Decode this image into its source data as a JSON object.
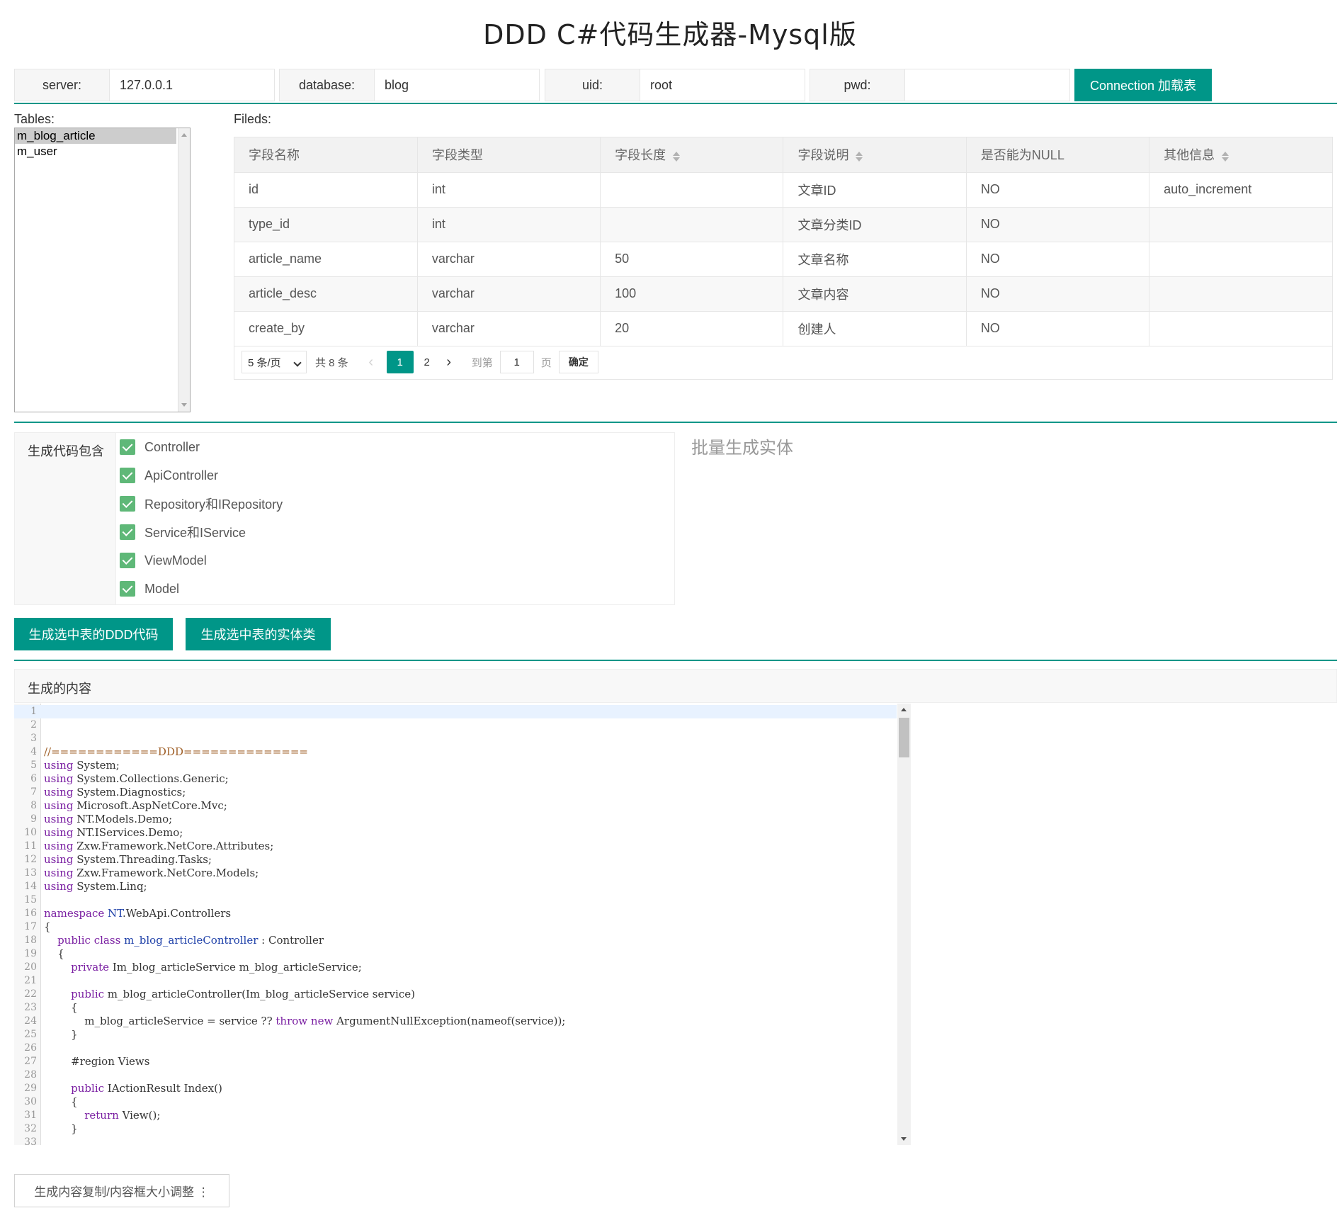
{
  "title": "DDD C#代码生成器-Mysql版",
  "connection": {
    "server_label": "server:",
    "server_value": "127.0.0.1",
    "database_label": "database:",
    "database_value": "blog",
    "uid_label": "uid:",
    "uid_value": "root",
    "pwd_label": "pwd:",
    "pwd_value": "",
    "connect_button": "Connection 加载表"
  },
  "tables": {
    "label": "Tables:",
    "items": [
      "m_blog_article",
      "m_user"
    ],
    "selected": "m_blog_article"
  },
  "fields": {
    "label": "Fileds:",
    "columns": [
      "字段名称",
      "字段类型",
      "字段长度",
      "字段说明",
      "是否能为NULL",
      "其他信息"
    ],
    "rows": [
      [
        "id",
        "int",
        "",
        "文章ID",
        "NO",
        "auto_increment"
      ],
      [
        "type_id",
        "int",
        "",
        "文章分类ID",
        "NO",
        ""
      ],
      [
        "article_name",
        "varchar",
        "50",
        "文章名称",
        "NO",
        ""
      ],
      [
        "article_desc",
        "varchar",
        "100",
        "文章内容",
        "NO",
        ""
      ],
      [
        "create_by",
        "varchar",
        "20",
        "创建人",
        "NO",
        ""
      ]
    ],
    "pager": {
      "page_size": "5 条/页",
      "total": "共 8 条",
      "prev": "‹",
      "pages": [
        "1",
        "2"
      ],
      "current": "1",
      "next": "›",
      "goto_label": "到第",
      "goto_value": "1",
      "page_unit": "页",
      "confirm": "确定"
    }
  },
  "options": {
    "label": "生成代码包含",
    "items": [
      "Controller",
      "ApiController",
      "Repository和IRepository",
      "Service和IService",
      "ViewModel",
      "Model"
    ]
  },
  "batch_title": "批量生成实体",
  "buttons": {
    "gen_ddd": "生成选中表的DDD代码",
    "gen_entity": "生成选中表的实体类",
    "copy_resize": "生成内容复制/内容框大小调整 ⋮"
  },
  "content_title": "生成的内容",
  "accent_color": "#009688",
  "code_lines": [
    "",
    "",
    "",
    "//============DDD==============",
    "using System;",
    "using System.Collections.Generic;",
    "using System.Diagnostics;",
    "using Microsoft.AspNetCore.Mvc;",
    "using NT.Models.Demo;",
    "using NT.IServices.Demo;",
    "using Zxw.Framework.NetCore.Attributes;",
    "using System.Threading.Tasks;",
    "using Zxw.Framework.NetCore.Models;",
    "using System.Linq;",
    "",
    "namespace NT.WebApi.Controllers",
    "{",
    "    public class m_blog_articleController : Controller",
    "    {",
    "        private Im_blog_articleService m_blog_articleService;",
    "",
    "        public m_blog_articleController(Im_blog_articleService service)",
    "        {",
    "            m_blog_articleService = service ?? throw new ArgumentNullException(nameof(service));",
    "        }",
    "",
    "        #region Views",
    "",
    "        public IActionResult Index()",
    "        {",
    "            return View();",
    "        }",
    ""
  ]
}
